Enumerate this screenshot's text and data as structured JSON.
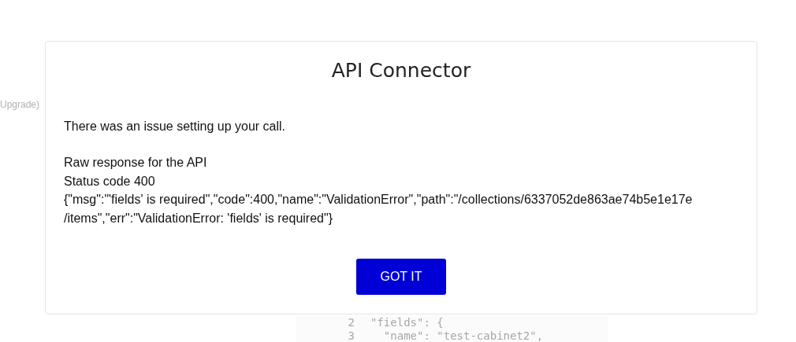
{
  "background": {
    "upgrade_text": "Upgrade)",
    "code_lines": [
      {
        "number": "2",
        "text": "\"fields\": {"
      },
      {
        "number": "3",
        "text": "  \"name\": \"test-cabinet2\","
      }
    ]
  },
  "dialog": {
    "title": "API Connector",
    "message": "There was an issue setting up your call.",
    "response_lines": [
      "Raw response for the API",
      "Status code 400",
      "{\"msg\":\"'fields' is required\",\"code\":400,\"name\":\"ValidationError\",\"path\":\"/collections/6337052de863ae74b5e1e17e /items\",\"err\":\"ValidationError: 'fields' is required\"}"
    ],
    "button": "GOT IT"
  }
}
